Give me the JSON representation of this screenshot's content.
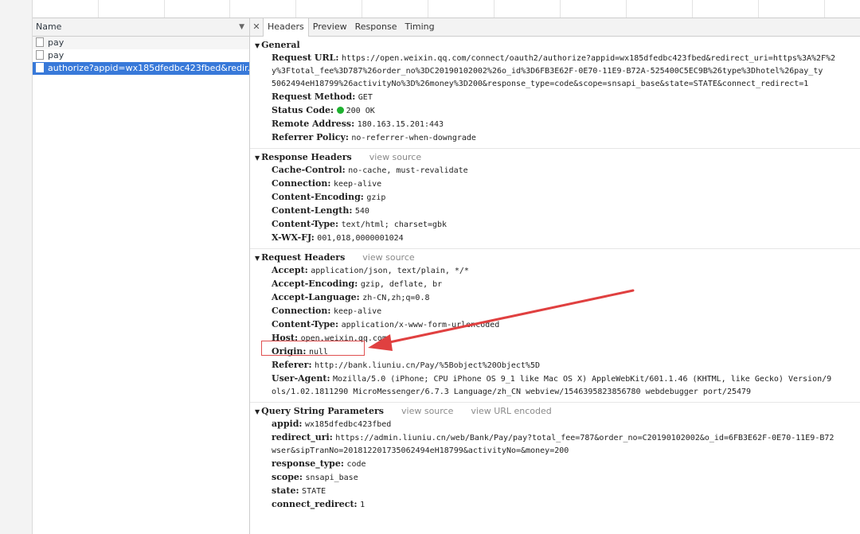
{
  "request_list": {
    "header": "Name",
    "rows": [
      {
        "name": "pay"
      },
      {
        "name": "pay"
      },
      {
        "name": "authorize?appid=wx185dfedbc423fbed&redir..."
      }
    ]
  },
  "tabs": [
    "Headers",
    "Preview",
    "Response",
    "Timing"
  ],
  "general": {
    "title": "General",
    "request_url_key": "Request URL:",
    "request_url_lines": [
      "https://open.weixin.qq.com/connect/oauth2/authorize?appid=wx185dfedbc423fbed&redirect_uri=https%3A%2F%2",
      "y%3Ftotal_fee%3D787%26order_no%3DC20190102002%26o_id%3D6FB3E62F-0E70-11E9-B72A-525400C5EC9B%26type%3Dhotel%26pay_ty",
      "5062494eH18799%26activityNo%3D%26money%3D200&response_type=code&scope=snsapi_base&state=STATE&connect_redirect=1"
    ],
    "fields": [
      {
        "k": "Request Method:",
        "v": "GET"
      },
      {
        "k": "Status Code:",
        "v": "200 OK",
        "status": true
      },
      {
        "k": "Remote Address:",
        "v": "180.163.15.201:443"
      },
      {
        "k": "Referrer Policy:",
        "v": "no-referrer-when-downgrade"
      }
    ]
  },
  "response_headers": {
    "title": "Response Headers",
    "link": "view source",
    "fields": [
      {
        "k": "Cache-Control:",
        "v": "no-cache, must-revalidate"
      },
      {
        "k": "Connection:",
        "v": "keep-alive"
      },
      {
        "k": "Content-Encoding:",
        "v": "gzip"
      },
      {
        "k": "Content-Length:",
        "v": "540"
      },
      {
        "k": "Content-Type:",
        "v": "text/html; charset=gbk"
      },
      {
        "k": "X-WX-FJ:",
        "v": "001,018,0000001024"
      }
    ]
  },
  "request_headers": {
    "title": "Request Headers",
    "link": "view source",
    "fields": [
      {
        "k": "Accept:",
        "v": "application/json, text/plain, */*"
      },
      {
        "k": "Accept-Encoding:",
        "v": "gzip, deflate, br"
      },
      {
        "k": "Accept-Language:",
        "v": "zh-CN,zh;q=0.8"
      },
      {
        "k": "Connection:",
        "v": "keep-alive"
      },
      {
        "k": "Content-Type:",
        "v": "application/x-www-form-urlencoded"
      },
      {
        "k": "Host:",
        "v": "open.weixin.qq.com"
      },
      {
        "k": "Origin:",
        "v": "null"
      },
      {
        "k": "Referer:",
        "v": "http://bank.liuniu.cn/Pay/%5Bobject%20Object%5D"
      },
      {
        "k": "User-Agent:",
        "v": "Mozilla/5.0 (iPhone; CPU iPhone OS 9_1 like Mac OS X) AppleWebKit/601.1.46 (KHTML, like Gecko) Version/9"
      }
    ],
    "ua_cont": "ols/1.02.1811290 MicroMessenger/6.7.3 Language/zh_CN webview/1546395823856780 webdebugger port/25479"
  },
  "query_params": {
    "title": "Query String Parameters",
    "link": "view source",
    "link2": "view URL encoded",
    "fields": [
      {
        "k": "appid:",
        "v": "wx185dfedbc423fbed"
      },
      {
        "k": "redirect_uri:",
        "v": "https://admin.liuniu.cn/web/Bank/Pay/pay?total_fee=787&order_no=C20190102002&o_id=6FB3E62F-0E70-11E9-B72"
      }
    ],
    "redirect_cont": "wser&sipTranNo=201812201735062494eH18799&activityNo=&money=200",
    "fields2": [
      {
        "k": "response_type:",
        "v": "code"
      },
      {
        "k": "scope:",
        "v": "snsapi_base"
      },
      {
        "k": "state:",
        "v": "STATE"
      },
      {
        "k": "connect_redirect:",
        "v": "1"
      }
    ]
  },
  "colors": {
    "selected": "#3879d9",
    "status_ok": "#1eb12f",
    "annotation": "#e04040"
  }
}
